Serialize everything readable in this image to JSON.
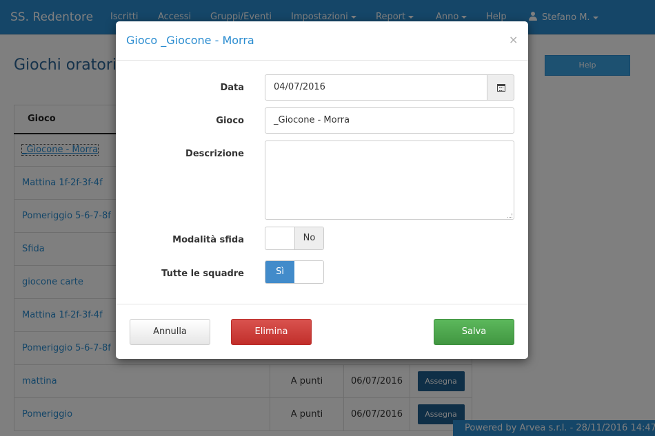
{
  "navbar": {
    "brand": "SS. Redentore",
    "items": [
      "Iscritti",
      "Accessi",
      "Gruppi/Eventi",
      "Impostazioni",
      "Report",
      "Anno"
    ],
    "help": "Help",
    "user": "Stefano M."
  },
  "page": {
    "title": "Giochi oratori",
    "help_button": "Help",
    "table_header": "Gioco",
    "rows": [
      {
        "name": "_Giocone - Morra"
      },
      {
        "name": "Mattina 1f-2f-3f-4f"
      },
      {
        "name": "Pomeriggio 5-6-7-8f"
      },
      {
        "name": "Sfida"
      },
      {
        "name": "giocone carte"
      },
      {
        "name": "Mattina 1f-2f-3f-4f"
      },
      {
        "name": "Pomeriggio 5-6-7-8f"
      },
      {
        "name": "mattina",
        "mode": "A punti",
        "date": "06/07/2016",
        "action": "Assegna"
      },
      {
        "name": "Pomeriggio",
        "mode": "A punti",
        "date": "06/07/2016",
        "action": "Assegna"
      }
    ],
    "footer": "Powered by Arvea s.r.l. - 28/11/2016 14:47"
  },
  "modal": {
    "title": "Gioco _Giocone - Morra",
    "close": "×",
    "labels": {
      "date": "Data",
      "game": "Gioco",
      "description": "Descrizione",
      "challenge": "Modalità sfida",
      "all_teams": "Tutte le squadre"
    },
    "values": {
      "date": "04/07/2016",
      "game": "_Giocone - Morra",
      "description": ""
    },
    "toggles": {
      "challenge": {
        "label": "No",
        "on": false
      },
      "all_teams": {
        "label": "Sì",
        "on": true
      }
    },
    "buttons": {
      "cancel": "Annulla",
      "delete": "Elimina",
      "save": "Salva"
    }
  },
  "colors": {
    "navbar": "#2a8cd0",
    "primary": "#428bca",
    "danger": "#d9534f",
    "success": "#5cb85c"
  }
}
